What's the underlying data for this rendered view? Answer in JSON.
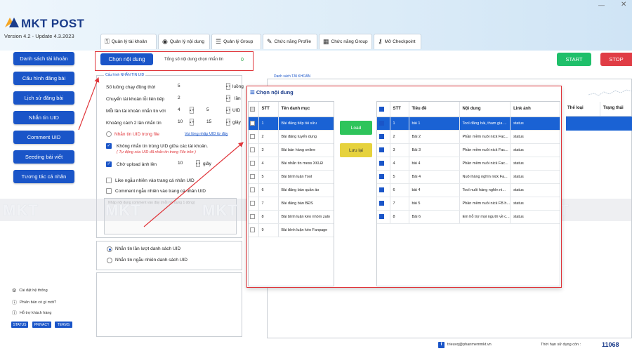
{
  "app": {
    "name": "MKT POST",
    "version": "Version 4.2 - Update 4.3.2023"
  },
  "window": {
    "minimize": "—",
    "close": "✕"
  },
  "tabs": [
    {
      "label": "Quản lý tài khoản",
      "icon": "key-icon"
    },
    {
      "label": "Quản lý nội dung",
      "icon": "eye-icon"
    },
    {
      "label": "Quản lý Group",
      "icon": "list-icon"
    },
    {
      "label": "Chức năng Profile",
      "icon": "pen-icon"
    },
    {
      "label": "Chức năng Group",
      "icon": "grid-icon"
    },
    {
      "label": "Mở Checkpoint",
      "icon": "unlock-icon"
    }
  ],
  "sidebar": {
    "items": [
      {
        "label": "Danh sách tài khoản"
      },
      {
        "label": "Cấu hình đăng bài"
      },
      {
        "label": "Lịch sử đăng bài"
      },
      {
        "label": "Nhắn tin UID"
      },
      {
        "label": "Comment UID"
      },
      {
        "label": "Seeding bài viết"
      },
      {
        "label": "Tương tác cá nhân"
      }
    ],
    "links": [
      {
        "label": "Cài đặt hệ thống",
        "icon": "gear-icon"
      },
      {
        "label": "Phiên bản có gì mới?",
        "icon": "help-icon"
      },
      {
        "label": "Hỗ trợ khách hàng",
        "icon": "help-icon"
      }
    ],
    "pills": [
      "STATUS",
      "PRIVACY",
      "TERMS"
    ]
  },
  "actionbar": {
    "select_button": "Chọn nội dung",
    "count_label": "Tổng số nội dung chọn nhắn tin",
    "count_value": "0",
    "start": "START",
    "stop": "STOP"
  },
  "config": {
    "title": "Cấu hình NHẮN TIN UID",
    "rows": [
      {
        "label": "Số luồng chạy đồng thời",
        "v1": "5",
        "unit": "luồng"
      },
      {
        "label": "Chuyển tài khoản lỗi liên tiếp",
        "v1": "2",
        "unit": "lần"
      },
      {
        "label": "Mỗi lần tài khoản nhắn tin với",
        "v1": "4",
        "v2": "5",
        "unit": "UID"
      },
      {
        "label": "Khoảng cách 2 lần nhắn tin",
        "v1": "10",
        "v2": "15",
        "unit": "giây"
      }
    ],
    "file_option": "Nhắn tin UID trong file",
    "file_link": "Vui lòng nhập  UID từ đây",
    "no_dup": "Không nhắn tin trùng UID giữa các tài khoản.",
    "no_dup_hint": "( Tự động xóa UID đã nhắn tin trong File trên )",
    "wait_upload": "Chờ upload ảnh lên",
    "wait_value": "10",
    "wait_unit": "giây",
    "like_random": "Like ngẫu nhiên vào trang cá nhân UID",
    "comment_random": "Comment ngẫu nhiên vào trang cá nhân UID",
    "comment_placeholder": "Nhập nội dung comment vào đây (mỗi nội dung 1 dòng)",
    "order_seq": "Nhắn tin lần lượt danh sách UID",
    "order_rand": "Nhắn tin ngẫu nhiên danh sách UID"
  },
  "accounts": {
    "title": "Danh sách TÀI KHOẢN",
    "headers": [
      "STT",
      "Tiêu đề",
      "Nội dung",
      "Link ảnh",
      "Thể loại",
      "Trạng thái"
    ]
  },
  "dialog": {
    "title": "Chọn nội dung",
    "load": "Load",
    "save": "Lưu lại",
    "left_headers": [
      "STT",
      "Tên danh mục"
    ],
    "left_rows": [
      {
        "stt": "1",
        "name": "Bài đăng tiếp tài sửu",
        "selected": true
      },
      {
        "stt": "2",
        "name": "Bài đăng tuyển dụng"
      },
      {
        "stt": "3",
        "name": "Bài bán hàng online"
      },
      {
        "stt": "4",
        "name": "Bài nhắn tin mess XKLĐ"
      },
      {
        "stt": "5",
        "name": "Bài bình luận Tool"
      },
      {
        "stt": "6",
        "name": "Bài đăng bán quần áo"
      },
      {
        "stt": "7",
        "name": "Bài đăng bán BĐS"
      },
      {
        "stt": "8",
        "name": "Bài bình luận kéo nhóm zalo"
      },
      {
        "stt": "9",
        "name": "Bài bình luận kéo Fanpage"
      }
    ],
    "right_headers": [
      "STT",
      "Tiêu đề",
      "Nội dung",
      "Link ảnh"
    ],
    "right_rows": [
      {
        "stt": "1",
        "title": "bài 1",
        "content": "Tool đăng bài, tham gia ...",
        "link": "status",
        "selected": true
      },
      {
        "stt": "2",
        "title": "Bài 2",
        "content": "Phần mềm nuôi nick Fac...",
        "link": "status"
      },
      {
        "stt": "3",
        "title": "Bài 3",
        "content": "Phần mềm nuôi nick Fac...",
        "link": "status"
      },
      {
        "stt": "4",
        "title": "bài 4",
        "content": "Phần mềm nuôi nick Fac...",
        "link": "status"
      },
      {
        "stt": "5",
        "title": "Bài 4",
        "content": "Nuôi hàng nghìn nick Fa...",
        "link": "status"
      },
      {
        "stt": "6",
        "title": "bài 4",
        "content": "Tool nuôi hàng nghìn ni...",
        "link": "status"
      },
      {
        "stt": "7",
        "title": "bài 5",
        "content": "Phần mềm nuôi nick FB h...",
        "link": "status"
      },
      {
        "stt": "8",
        "title": "Bài 6",
        "content": "Em hỗ trợ mọi người về c...",
        "link": "status"
      }
    ]
  },
  "watermark": "MKT",
  "footer": {
    "email": "trieuvq@phanmemmkt.vn",
    "expiry_label": "Thời hạn sử dụng còn :",
    "expiry_value": "11068"
  },
  "colors": {
    "primary": "#1a55c8",
    "start": "#1fbf6a",
    "stop": "#e03c45",
    "highlight": "#e0353a"
  }
}
